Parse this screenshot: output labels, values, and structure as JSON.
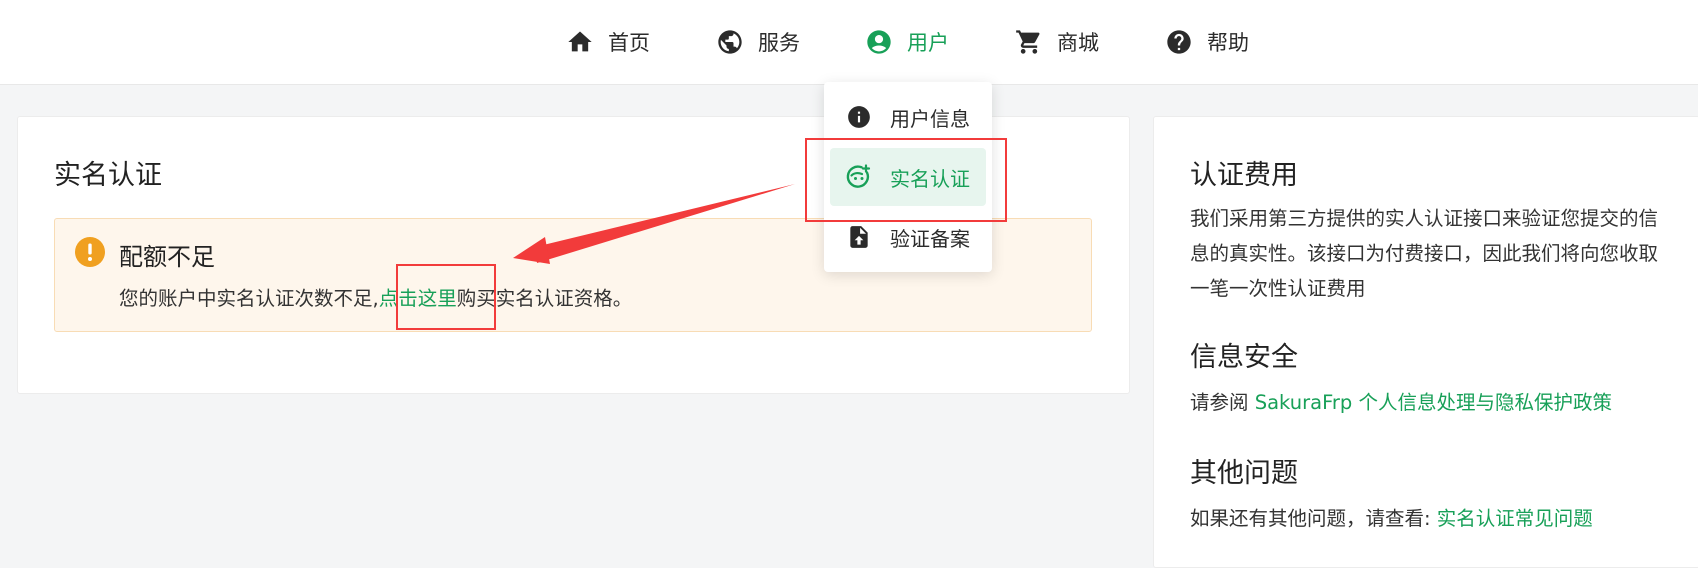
{
  "nav": {
    "items": [
      {
        "label": "首页",
        "icon": "home-icon"
      },
      {
        "label": "服务",
        "icon": "globe-icon"
      },
      {
        "label": "用户",
        "icon": "user-circle-icon"
      },
      {
        "label": "商城",
        "icon": "cart-icon"
      },
      {
        "label": "帮助",
        "icon": "help-icon"
      }
    ],
    "active_index": 2
  },
  "user_menu": {
    "items": [
      {
        "label": "用户信息",
        "icon": "info-icon"
      },
      {
        "label": "实名认证",
        "icon": "face-add-icon"
      },
      {
        "label": "验证备案",
        "icon": "file-upload-icon"
      }
    ],
    "active_index": 1
  },
  "main": {
    "title": "实名认证",
    "alert": {
      "title": "配额不足",
      "text_before": "您的账户中实名认证次数不足,",
      "link": "点击这里",
      "text_after": "购买实名认证资格。"
    }
  },
  "sidebar": {
    "fee_heading": "认证费用",
    "fee_text": "我们采用第三方提供的实人认证接口来验证您提交的信息的真实性。该接口为付费接口，因此我们将向您收取一笔一次性认证费用",
    "security_heading": "信息安全",
    "security_prefix": "请参阅",
    "security_link": "SakuraFrp 个人信息处理与隐私保护政策",
    "other_heading": "其他问题",
    "other_prefix": "如果还有其他问题，请查看:",
    "other_link": "实名认证常见问题"
  },
  "colors": {
    "accent": "#18a058",
    "annotation": "#f23b3b",
    "warning": "#f0a020"
  }
}
